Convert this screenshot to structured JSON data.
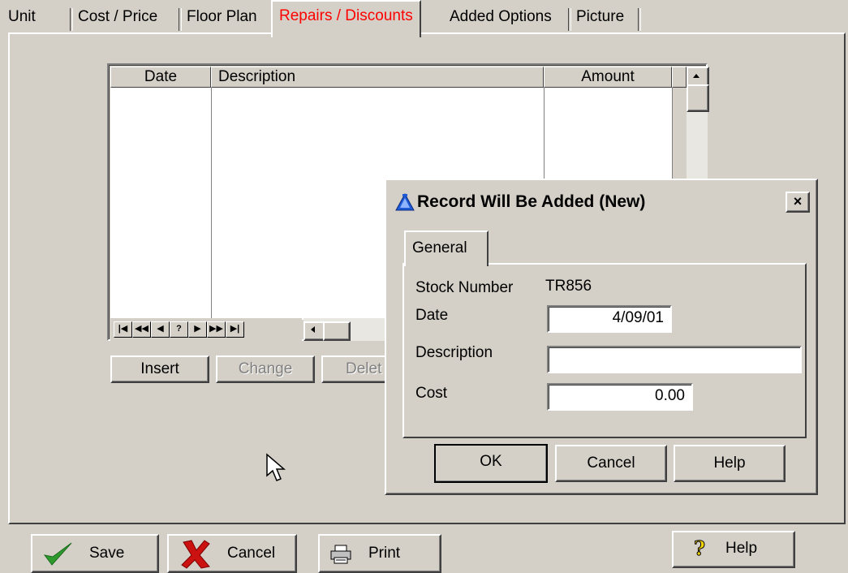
{
  "tabs": [
    "Unit",
    "Cost / Price",
    "Floor Plan",
    "Repairs / Discounts",
    "Added Options",
    "Picture"
  ],
  "active_tab": "Repairs / Discounts",
  "grid": {
    "columns": [
      "Date",
      "Description",
      "Amount"
    ],
    "nav_buttons": [
      "|◀",
      "◀◀",
      "◀",
      "?",
      "▶",
      "▶▶",
      "▶|"
    ]
  },
  "grid_buttons": {
    "insert": "Insert",
    "change": "Change",
    "delete": "Delet"
  },
  "dialog": {
    "title": "Record Will Be Added  (New)",
    "close": "×",
    "tab": "General",
    "stock_number_label": "Stock Number",
    "stock_number_value": "TR856",
    "date_label": "Date",
    "date_value": "4/09/01",
    "description_label": "Description",
    "description_value": "",
    "cost_label": "Cost",
    "cost_value": "0.00",
    "ok": "OK",
    "cancel": "Cancel",
    "help": "Help"
  },
  "toolbar": {
    "save": "Save",
    "cancel": "Cancel",
    "print": "Print",
    "help": "Help"
  }
}
